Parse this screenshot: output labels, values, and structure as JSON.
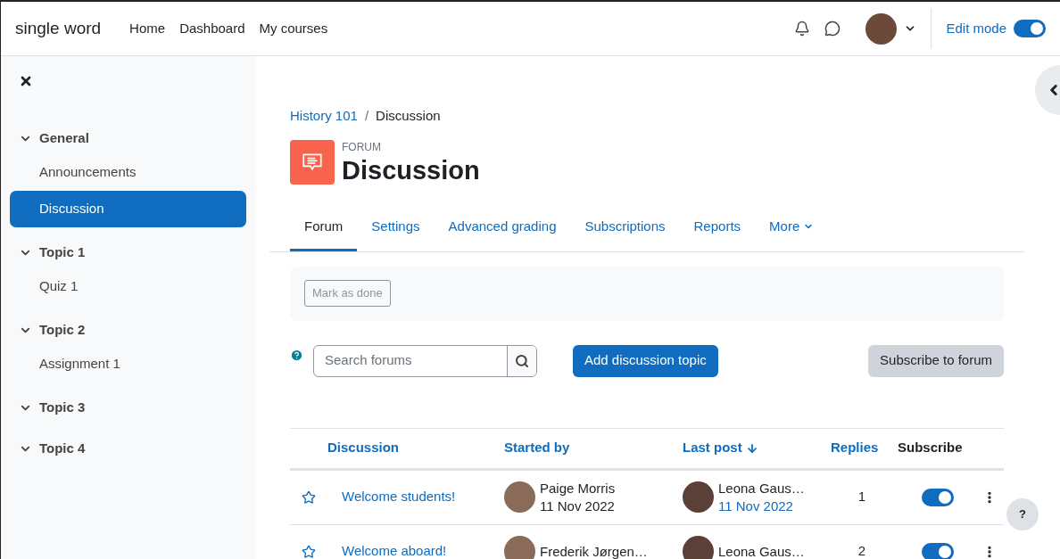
{
  "navbar": {
    "site_name": "single word",
    "links": [
      {
        "label": "Home"
      },
      {
        "label": "Dashboard"
      },
      {
        "label": "My courses"
      }
    ],
    "edit_mode": {
      "label": "Edit mode",
      "on": true
    }
  },
  "sidebar": {
    "sections": [
      {
        "title": "General",
        "expanded": true,
        "items": [
          {
            "label": "Announcements",
            "selected": false
          },
          {
            "label": "Discussion",
            "selected": true
          }
        ]
      },
      {
        "title": "Topic 1",
        "expanded": true,
        "items": [
          {
            "label": "Quiz 1",
            "selected": false
          }
        ]
      },
      {
        "title": "Topic 2",
        "expanded": true,
        "items": [
          {
            "label": "Assignment 1",
            "selected": false
          }
        ]
      },
      {
        "title": "Topic 3",
        "expanded": true
      },
      {
        "title": "Topic 4",
        "expanded": true
      }
    ]
  },
  "breadcrumb": [
    {
      "label": "History 101",
      "kind": "link"
    },
    {
      "label": "/",
      "kind": "separator"
    },
    {
      "label": "Discussion",
      "kind": "current"
    }
  ],
  "activity": {
    "type_label": "FORUM",
    "title": "Discussion"
  },
  "tabs": [
    {
      "label": "Forum",
      "selected": true
    },
    {
      "label": "Settings",
      "selected": false
    },
    {
      "label": "Advanced grading",
      "selected": false
    },
    {
      "label": "Subscriptions",
      "selected": false
    },
    {
      "label": "Reports",
      "selected": false
    },
    {
      "label": "More",
      "selected": false
    }
  ],
  "completion": {
    "button": "Mark as done"
  },
  "search": {
    "placeholder": "Search forums"
  },
  "actions": {
    "add": "Add discussion topic",
    "subscribe": "Subscribe to forum"
  },
  "table": {
    "columns": [
      {
        "label": "Discussion",
        "sortable": true
      },
      {
        "label": "Started by",
        "sortable": true
      },
      {
        "label": "Last post",
        "sortable": true,
        "sorted": true
      },
      {
        "label": "Replies",
        "sortable": true
      },
      {
        "label": "Subscribe",
        "sortable": false
      }
    ],
    "rows": [
      {
        "starred": false,
        "title": "Welcome students!",
        "author": "Paige Morris",
        "started": "11 Nov 2022",
        "last_author": "Leona Gaus…",
        "last_date": "11 Nov 2022",
        "replies": "1",
        "subscribed": true
      },
      {
        "starred": false,
        "title": "Welcome aboard!",
        "author": "Frederik Jørgen…",
        "last_author": "Leona Gaus…",
        "replies": "2",
        "subscribed": true
      }
    ]
  },
  "help_button": {
    "label": "?"
  }
}
